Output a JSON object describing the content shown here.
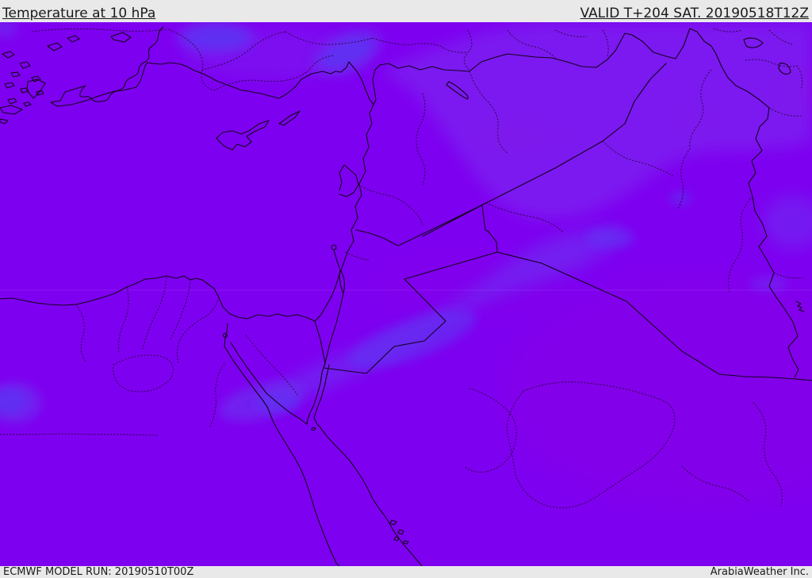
{
  "header": {
    "title": "Temperature at 10 hPa",
    "valid": "VALID T+204 SAT. 20190518T12Z"
  },
  "footer": {
    "model_run": "ECMWF MODEL RUN: 20190510T00Z",
    "branding": "ArabiaWeather Inc."
  },
  "map": {
    "region": "Middle East / Eastern Mediterranean",
    "colors": {
      "base": "#7e00f0",
      "cool_zone": "#7a2cf0",
      "cool_band": "#6e2df2",
      "cool_mid": "#6a35f0",
      "cool_core": "#5a34f3",
      "cool_core2": "#6136f2",
      "warm_patch": "#9104de",
      "warm_zone": "#8b00e2",
      "line": "#14001c",
      "admin_line": "#1d0520",
      "grid_line": "#ffffff"
    }
  },
  "chrome": {
    "bar_bg": "#e9e9e9",
    "text_color": "#1a1a1a"
  }
}
